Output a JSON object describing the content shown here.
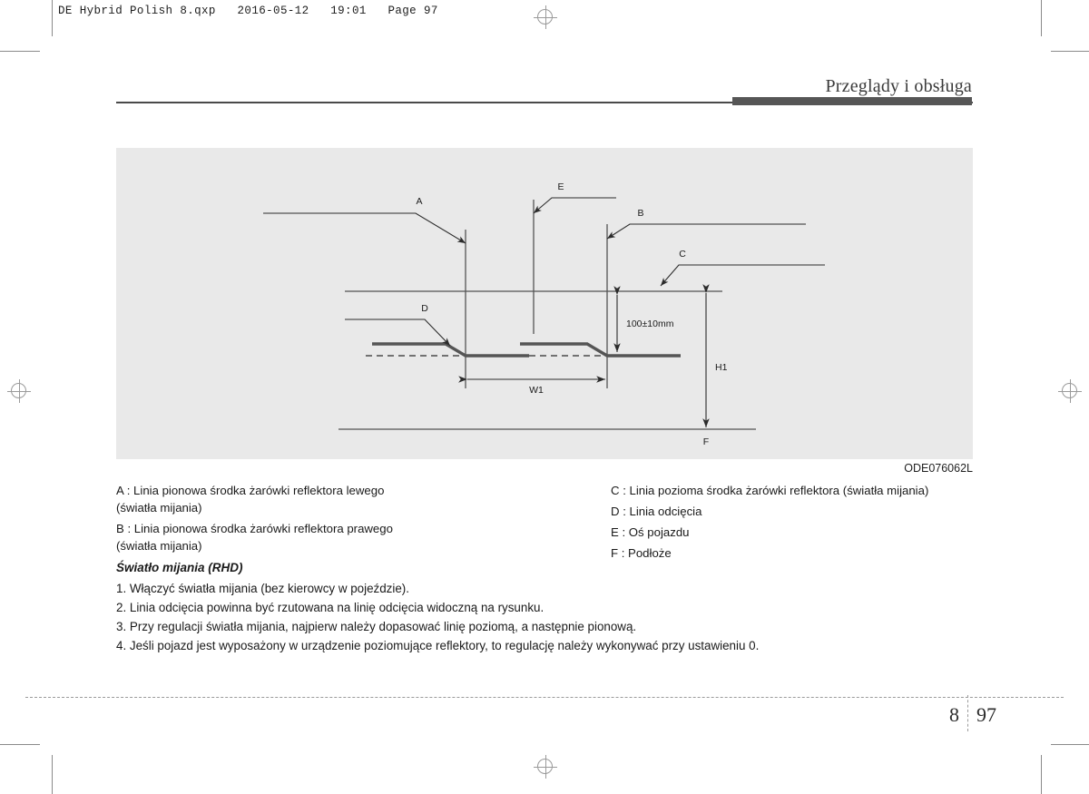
{
  "slug": {
    "text": "DE Hybrid Polish 8.qxp   2016-05-12   19:01   Page 97"
  },
  "header": {
    "chapter_title": "Przeglądy i obsługa"
  },
  "figure": {
    "code": "ODE076062L",
    "labels": {
      "a": "A",
      "b": "B",
      "c": "C",
      "d": "D",
      "e": "E",
      "f": "F"
    },
    "dimensions": {
      "vertical_offset": "100±10mm",
      "width": "W1",
      "height": "H1"
    }
  },
  "legend": {
    "left": [
      "A : Linia pionowa środka żarówki reflektora lewego\n   (światła mijania)",
      "B : Linia pionowa środka żarówki reflektora prawego\n   (światła mijania)"
    ],
    "right": [
      "C : Linia pozioma środka żarówki reflektora (światła mijania)",
      "D : Linia odcięcia",
      "E : Oś pojazdu",
      "F : Podłoże"
    ]
  },
  "instructions": {
    "heading": "Światło mijania (RHD)",
    "items": [
      "1. Włączyć światła mijania (bez kierowcy w pojeździe).",
      "2. Linia odcięcia powinna być rzutowana na linię odcięcia widoczną na rysunku.",
      "3. Przy regulacji światła mijania, najpierw należy dopasować linię poziomą, a następnie pionową.",
      "4. Jeśli pojazd jest wyposażony w urządzenie poziomujące reflektory, to regulację należy wykonywać przy ustawieniu 0."
    ]
  },
  "footer": {
    "chapter": "8",
    "page": "97"
  },
  "colors": {
    "panel_bg": "#e9e9e9",
    "rule": "#4a4a4a",
    "bar": "#565656",
    "text": "#1a1a1a"
  }
}
